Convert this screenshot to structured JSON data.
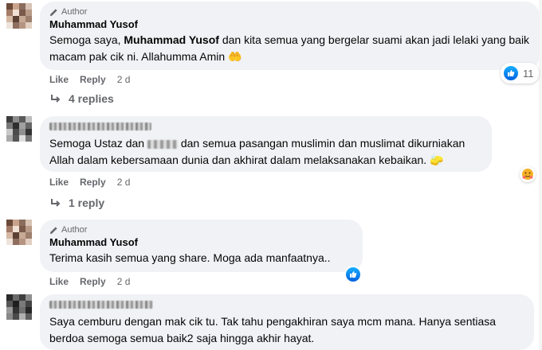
{
  "comments": [
    {
      "author_badge": "Author",
      "name": "Muhammad Yusof",
      "text_before": "Semoga saya, ",
      "text_bold": "Muhammad Yusof",
      "text_after": " dan kita semua yang bergelar suami akan jadi lelaki yang baik macam pak cik ni. Allahumma Amin",
      "emoji": "🤲",
      "like": "Like",
      "reply": "Reply",
      "time": "2 d",
      "reaction_count": "11",
      "replies_label": "4 replies"
    },
    {
      "text_before": "Semoga Ustaz dan ",
      "text_after": " dan semua pasangan muslimin dan muslimat dikurniakan Allah dalam kebersamaan dunia dan akhirat dalam melaksanakan kebaikan.",
      "emoji": "🧽",
      "like": "Like",
      "reply": "Reply",
      "time": "2 d",
      "replies_label": "1 reply"
    },
    {
      "author_badge": "Author",
      "name": "Muhammad Yusof",
      "text": "Terima kasih semua yang share. Moga ada manfaatnya..",
      "like": "Like",
      "reply": "Reply",
      "time": "2 d"
    },
    {
      "text": "Saya cemburu dengan mak cik tu. Tak tahu pengakhiran saya mcm mana. Hanya sentiasa berdoa semoga semua baik2 saja hingga akhir hayat."
    }
  ],
  "colors": {
    "bubble": "#f0f2f5",
    "meta": "#65676b",
    "like_blue": "#1877f2"
  },
  "icons": {
    "badge": "pencil-icon",
    "reply_arrow": "reply-arrow-icon",
    "like": "like-thumb-icon",
    "reaction2": "hug-emoji-icon"
  }
}
